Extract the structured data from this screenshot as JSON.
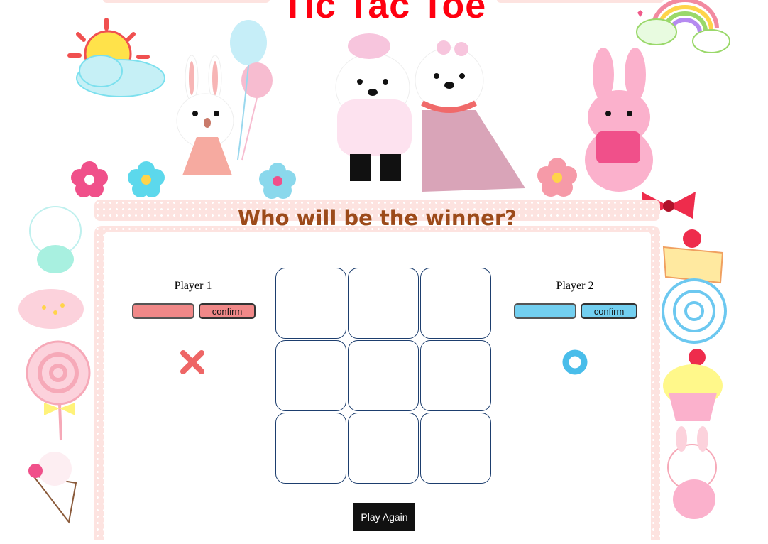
{
  "title": "Tic Tac Toe",
  "subtitle": "Who will be the winner?",
  "players": [
    {
      "label": "Player 1",
      "name_value": "",
      "confirm_label": "confirm",
      "symbol": "x-mark-icon",
      "color": "#f08888"
    },
    {
      "label": "Player 2",
      "name_value": "",
      "confirm_label": "confirm",
      "symbol": "o-ring-icon",
      "color": "#72cff0"
    }
  ],
  "board": {
    "cells": [
      "",
      "",
      "",
      "",
      "",
      "",
      "",
      "",
      ""
    ],
    "border_color": "#1d3e6e"
  },
  "play_again_label": "Play Again",
  "colors": {
    "title": "#ff0010",
    "subtitle": "#9c4a1a",
    "frame_pink": "#fde3e0"
  }
}
